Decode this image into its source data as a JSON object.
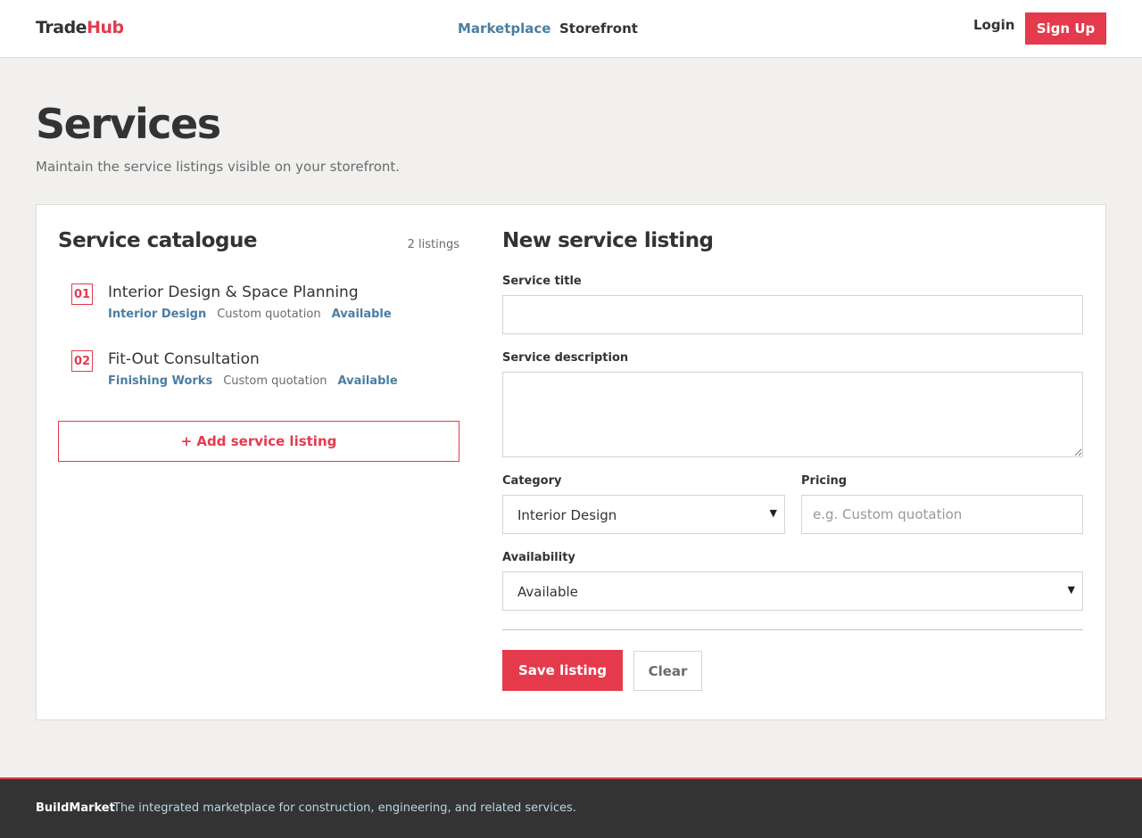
{
  "header": {
    "brand_part1": "Trade",
    "brand_part2": "Hub",
    "nav": [
      {
        "label": "Marketplace",
        "active": true
      },
      {
        "label": "Storefront",
        "active": false
      }
    ],
    "login_label": "Login",
    "signup_label": "Sign Up"
  },
  "page": {
    "title": "Services",
    "subtitle": "Maintain the service listings visible on your storefront."
  },
  "catalogue": {
    "title": "Service catalogue",
    "count": "2 listings",
    "items": [
      {
        "num": "01",
        "name": "Interior Design & Space Planning",
        "category": "Interior Design",
        "pricing": "Custom quotation",
        "availability": "Available"
      },
      {
        "num": "02",
        "name": "Fit-Out Consultation",
        "category": "Finishing Works",
        "pricing": "Custom quotation",
        "availability": "Available"
      }
    ],
    "add_label": "+ Add service listing"
  },
  "form": {
    "title": "New service listing",
    "service_title_label": "Service title",
    "service_title_value": "",
    "description_label": "Service description",
    "description_value": "",
    "category_label": "Category",
    "category_value": "Interior Design",
    "pricing_label": "Pricing",
    "pricing_placeholder": "e.g. Custom quotation",
    "availability_label": "Availability",
    "availability_value": "Available",
    "save_label": "Save listing",
    "clear_label": "Clear"
  },
  "footer": {
    "brand": "BuildMarket",
    "tagline": "The integrated marketplace for construction, engineering, and related services."
  },
  "colors": {
    "accent": "#e53a4c",
    "link_blue": "#4a7ea2",
    "footer_bg": "#333333"
  }
}
